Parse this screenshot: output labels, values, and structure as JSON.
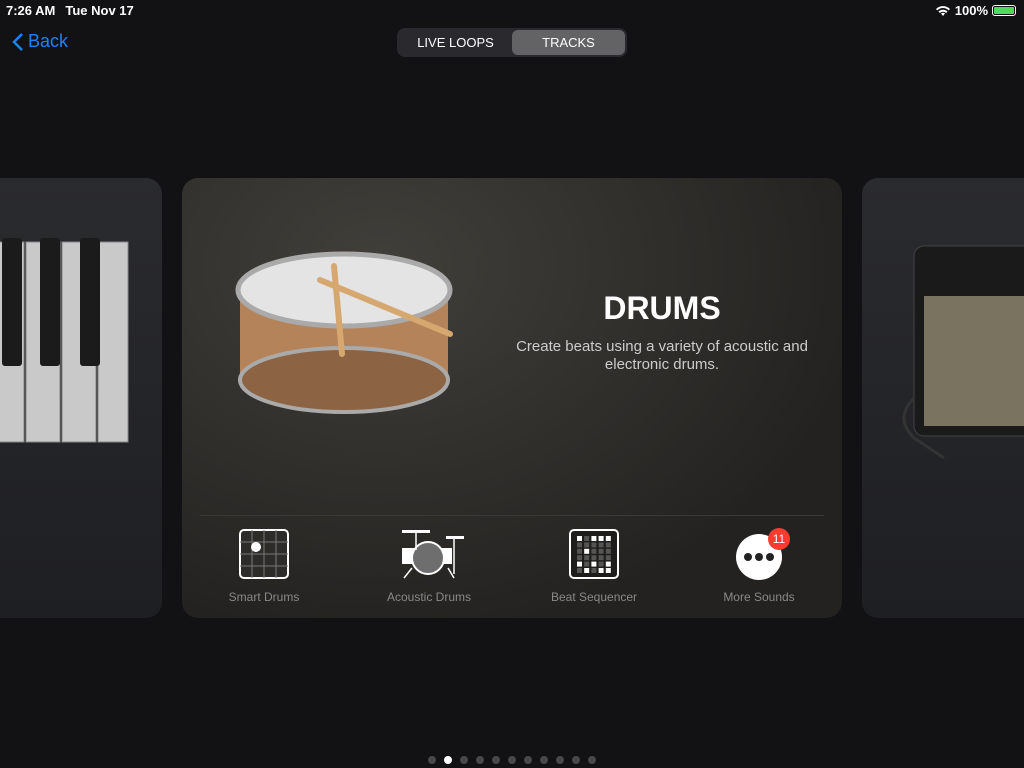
{
  "status": {
    "time": "7:26 AM",
    "date": "Tue Nov 17",
    "battery": "100%",
    "battery_level": 100,
    "battery_color": "#4cd964"
  },
  "nav": {
    "back_label": "Back",
    "tabs": [
      {
        "label": "LIVE LOOPS",
        "active": false
      },
      {
        "label": "TRACKS",
        "active": true
      }
    ]
  },
  "card": {
    "title": "DRUMS",
    "description": "Create beats using a variety of acoustic and electronic drums.",
    "options": [
      {
        "label": "Smart Drums",
        "icon": "smart-drums-grid-icon"
      },
      {
        "label": "Acoustic Drums",
        "icon": "drum-kit-icon"
      },
      {
        "label": "Beat Sequencer",
        "icon": "beat-sequencer-icon"
      },
      {
        "label": "More Sounds",
        "icon": "more-icon",
        "badge": "11"
      }
    ]
  },
  "pager": {
    "count": 11,
    "current": 2
  },
  "accent": "#1a82fb"
}
